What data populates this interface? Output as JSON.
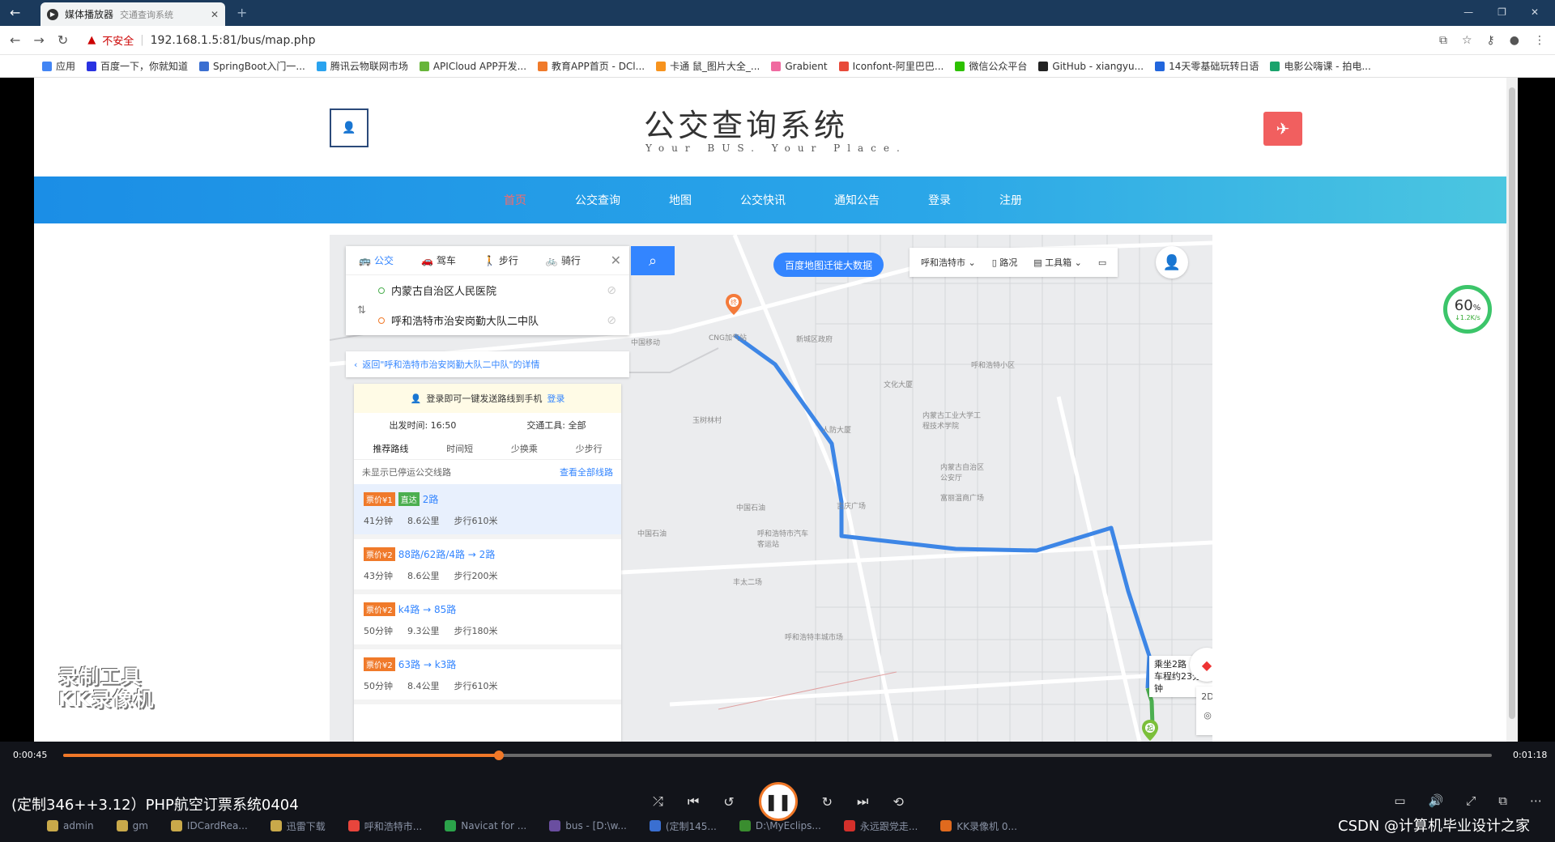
{
  "browser": {
    "tab_title": "媒体播放器",
    "tab_subtitle": "交通查询系统",
    "insecure_label": "不安全",
    "url": "192.168.1.5:81/bus/map.php",
    "bookmarks": [
      {
        "label": "应用",
        "color": "#4285f4"
      },
      {
        "label": "百度一下，你就知道",
        "color": "#2932e1"
      },
      {
        "label": "SpringBoot入门一...",
        "color": "#3b6fd1"
      },
      {
        "label": "腾讯云物联网市场",
        "color": "#2aa3ef"
      },
      {
        "label": "APICloud APP开发...",
        "color": "#67b53a"
      },
      {
        "label": "教育APP首页 - DCl...",
        "color": "#f07a2a"
      },
      {
        "label": "卡通 鼠_图片大全_...",
        "color": "#f7931e"
      },
      {
        "label": "Grabient",
        "color": "#f06aa0"
      },
      {
        "label": "Iconfont-阿里巴巴...",
        "color": "#e84a3a"
      },
      {
        "label": "微信公众平台",
        "color": "#2dc100"
      },
      {
        "label": "GitHub - xiangyu...",
        "color": "#222222"
      },
      {
        "label": "14天零基础玩转日语",
        "color": "#2266dd"
      },
      {
        "label": "电影公嗨课 - 拍电...",
        "color": "#1aa36c"
      }
    ]
  },
  "site": {
    "title": "公交查询系统",
    "subtitle": "Your BUS. Your Place.",
    "nav": [
      "首页",
      "公交查询",
      "地图",
      "公交快讯",
      "通知公告",
      "登录",
      "注册"
    ],
    "nav_active": 0
  },
  "map": {
    "modes": [
      "公交",
      "驾车",
      "步行",
      "骑行"
    ],
    "start": "内蒙古自治区人民医院",
    "end": "呼和浩特市治安岗勤大队二中队",
    "back_link": "返回\"呼和浩特市治安岗勤大队二中队\"的详情",
    "banner": "百度地图迁徙大数据",
    "city": "呼和浩特市",
    "tools": [
      "路况",
      "工具箱"
    ],
    "login_tip": "登录即可一键发送路线到手机",
    "login_link": "登录",
    "depart_time": "出发时间: 16:50",
    "transport": "交通工具: 全部",
    "sorts": [
      "推荐路线",
      "时间短",
      "少换乘",
      "少步行"
    ],
    "hint": "未显示已停运公交线路",
    "hint_link": "查看全部线路",
    "plans": [
      {
        "price": "票价¥1",
        "express": "直达",
        "route": "2路",
        "time": "41分钟",
        "dist": "8.6公里",
        "walk": "步行610米"
      },
      {
        "price": "票价¥2",
        "express": "",
        "route": "88路/62路/4路 → 2路",
        "time": "43分钟",
        "dist": "8.6公里",
        "walk": "步行200米"
      },
      {
        "price": "票价¥2",
        "express": "",
        "route": "k4路 → 85路",
        "time": "50分钟",
        "dist": "9.3公里",
        "walk": "步行180米"
      },
      {
        "price": "票价¥2",
        "express": "",
        "route": "63路 → k3路",
        "time": "50分钟",
        "dist": "8.4公里",
        "walk": "步行610米"
      }
    ],
    "tooltip_line1": "乘坐2路",
    "tooltip_line2": "车程约23分钟",
    "ctrl_2d": "2D",
    "map_labels": [
      "中国移动",
      "CNG加气站",
      "新城区政府",
      "呼和浩特小区",
      "文化大厦",
      "玉树林村",
      "人防大厦",
      "内蒙古工业大学工程技术学院",
      "内蒙古自治区公安厅",
      "中国石油",
      "中国石油",
      "呼和浩特市汽车客运站",
      "富丽温商广场",
      "吉庆广场",
      "丰太二场",
      "呼和浩特丰城市场"
    ]
  },
  "net_gauge": {
    "percent": "60",
    "speed": "↓1.2K/s"
  },
  "player": {
    "time_current": "0:00:45",
    "time_total": "0:01:18",
    "progress": 0.305,
    "title": "(定制346++3.12）PHP航空订票系统0404",
    "watermark_line1": "录制工具",
    "watermark_line2": "KK录像机"
  },
  "taskbar": [
    {
      "label": "admin",
      "color": "#c9a94a"
    },
    {
      "label": "gm",
      "color": "#c9a94a"
    },
    {
      "label": "IDCardRea...",
      "color": "#c9a94a"
    },
    {
      "label": "迅雷下载",
      "color": "#c9a94a"
    },
    {
      "label": "呼和浩特市...",
      "color": "#e8453c"
    },
    {
      "label": "Navicat for ...",
      "color": "#2ba34a"
    },
    {
      "label": "bus - [D:\\w...",
      "color": "#6a4ea0"
    },
    {
      "label": "(定制145...",
      "color": "#3a6fd1"
    },
    {
      "label": "D:\\MyEclips...",
      "color": "#3a8d2f"
    },
    {
      "label": "永远跟党走...",
      "color": "#d4302b"
    },
    {
      "label": "KK录像机 0...",
      "color": "#e06a1e"
    }
  ],
  "csdn": "CSDN @计算机毕业设计之家"
}
